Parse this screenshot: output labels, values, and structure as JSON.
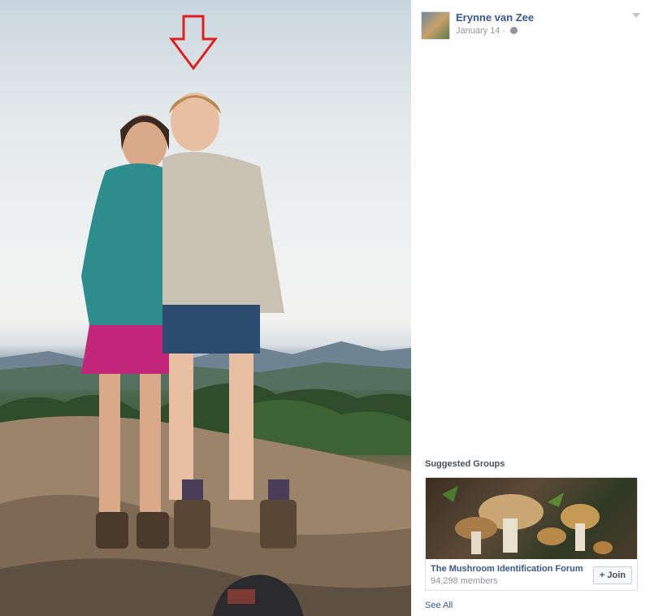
{
  "post": {
    "author": "Erynne van Zee",
    "date": "January 14",
    "privacy_icon": "globe-icon",
    "options_icon": "chevron-down-icon"
  },
  "suggested_groups": {
    "title": "Suggested Groups",
    "groups": [
      {
        "name": "The Mushroom Identification Forum",
        "members": "94,298 members",
        "join_label": "+ Join"
      }
    ],
    "see_all": "See All"
  },
  "colors": {
    "link": "#365899",
    "muted": "#90949c",
    "arrow": "#e02020"
  }
}
